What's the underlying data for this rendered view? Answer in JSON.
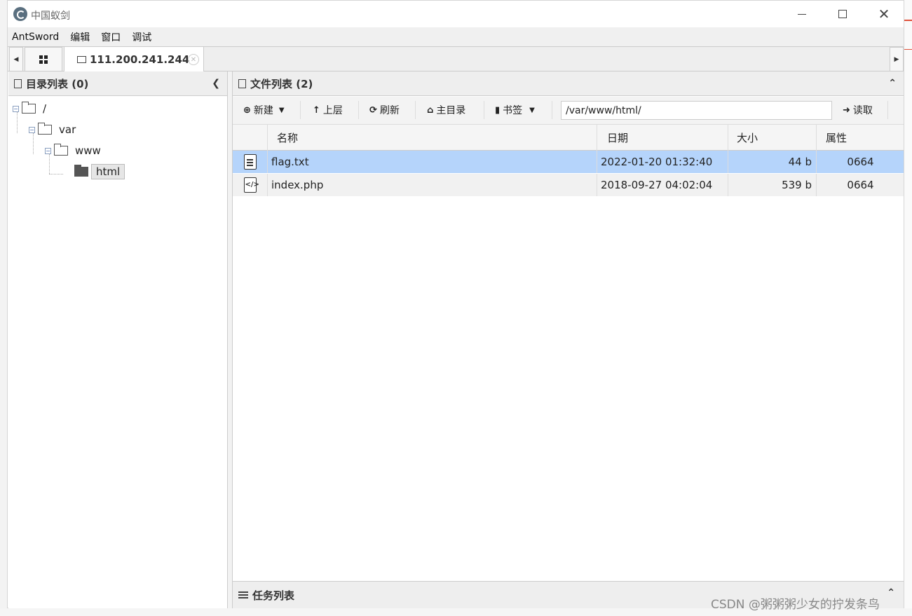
{
  "window": {
    "title": "中国蚁剑"
  },
  "menu": {
    "items": [
      "AntSword",
      "编辑",
      "窗口",
      "调试"
    ]
  },
  "tabs": {
    "active_label": "111.200.241.244"
  },
  "dir_panel": {
    "header": "目录列表 (0)",
    "tree": [
      {
        "label": "/",
        "depth": 0
      },
      {
        "label": "var",
        "depth": 1
      },
      {
        "label": "www",
        "depth": 2
      },
      {
        "label": "html",
        "depth": 3,
        "selected": true
      }
    ]
  },
  "file_panel": {
    "header": "文件列表 (2)",
    "toolbar": {
      "new_label": "新建",
      "up_label": "上层",
      "refresh_label": "刷新",
      "home_label": "主目录",
      "bookmark_label": "书签",
      "path_value": "/var/www/html/",
      "read_label": "读取"
    },
    "columns": {
      "name": "名称",
      "date": "日期",
      "size": "大小",
      "attr": "属性"
    },
    "rows": [
      {
        "name": "flag.txt",
        "date": "2022-01-20 01:32:40",
        "size": "44 b",
        "attr": "0664",
        "icon": "text-file-icon",
        "selected": true
      },
      {
        "name": "index.php",
        "date": "2018-09-27 04:02:04",
        "size": "539 b",
        "attr": "0664",
        "icon": "code-file-icon",
        "selected": false
      }
    ]
  },
  "task_panel": {
    "header": "任务列表"
  },
  "watermark": "CSDN @粥粥粥少女的拧发条鸟",
  "colors": {
    "selected_row": "#b5d4fb",
    "accent_bg": "#f0f0f0"
  }
}
